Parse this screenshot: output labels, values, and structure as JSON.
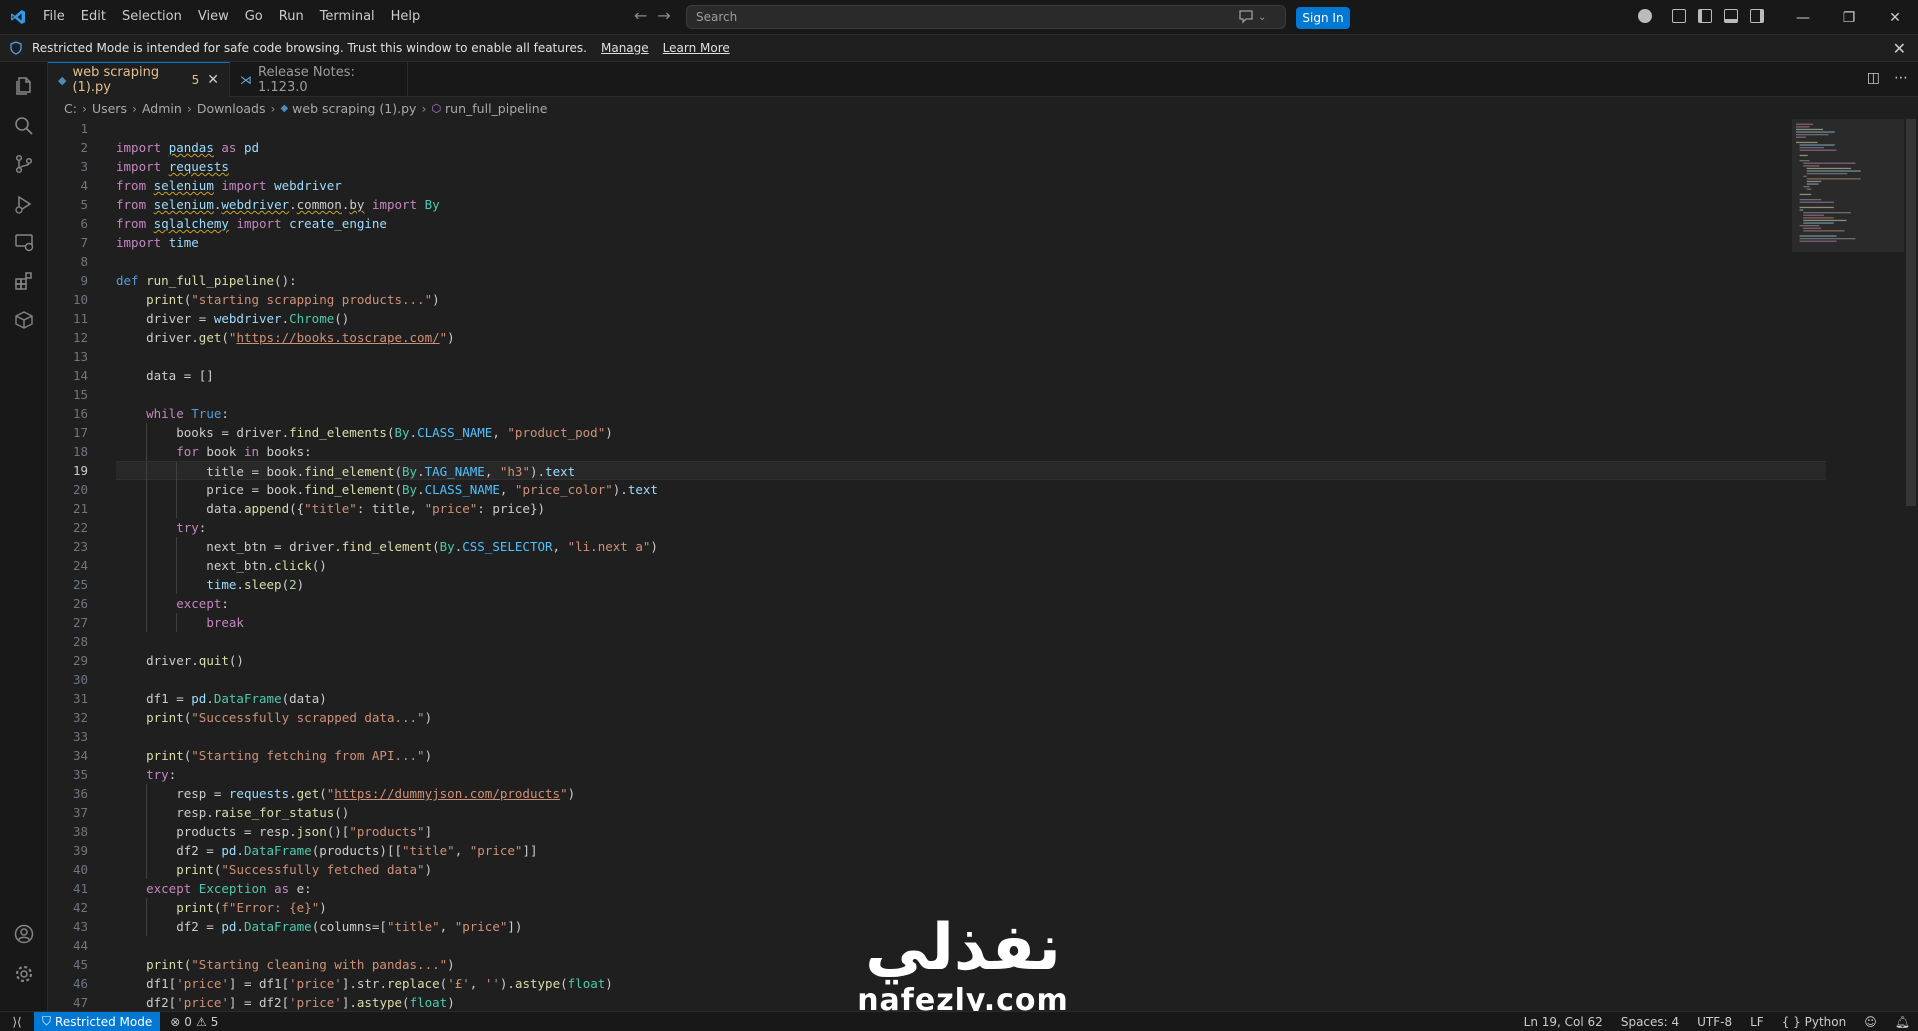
{
  "menu": [
    "File",
    "Edit",
    "Selection",
    "View",
    "Go",
    "Run",
    "Terminal",
    "Help"
  ],
  "search": {
    "placeholder": "Search"
  },
  "signin": "Sign In",
  "banner": {
    "text": "Restricted Mode is intended for safe code browsing. Trust this window to enable all features.",
    "manage": "Manage",
    "learn_more": "Learn More"
  },
  "tabs": [
    {
      "label": "web scraping (1).py",
      "badge": "5",
      "active": true
    },
    {
      "label": "Release Notes: 1.123.0",
      "active": false
    }
  ],
  "breadcrumb": [
    "C:",
    "Users",
    "Admin",
    "Downloads",
    "web scraping (1).py",
    "run_full_pipeline"
  ],
  "editor": {
    "current_line": 19,
    "lines": [
      "",
      "import pandas as pd",
      "import requests",
      "from selenium import webdriver",
      "from selenium.webdriver.common.by import By",
      "from sqlalchemy import create_engine",
      "import time",
      "",
      "def run_full_pipeline():",
      "    print(\"starting scrapping products...\")",
      "    driver = webdriver.Chrome()",
      "    driver.get(\"https://books.toscrape.com/\")",
      "",
      "    data = []",
      "",
      "    while True:",
      "        books = driver.find_elements(By.CLASS_NAME, \"product_pod\")",
      "        for book in books:",
      "            title = book.find_element(By.TAG_NAME, \"h3\").text",
      "            price = book.find_element(By.CLASS_NAME, \"price_color\").text",
      "            data.append({\"title\": title, \"price\": price})",
      "        try:",
      "            next_btn = driver.find_element(By.CSS_SELECTOR, \"li.next a\")",
      "            next_btn.click()",
      "            time.sleep(2)",
      "        except:",
      "            break",
      "",
      "    driver.quit()",
      "",
      "    df1 = pd.DataFrame(data)",
      "    print(\"Successfully scrapped data...\")",
      "",
      "    print(\"Starting fetching from API...\")",
      "    try:",
      "        resp = requests.get(\"https://dummyjson.com/products\")",
      "        resp.raise_for_status()",
      "        products = resp.json()[\"products\"]",
      "        df2 = pd.DataFrame(products)[[\"title\", \"price\"]]",
      "        print(\"Successfully fetched data\")",
      "    except Exception as e:",
      "        print(f\"Error: {e}\")",
      "        df2 = pd.DataFrame(columns=[\"title\", \"price\"])",
      "",
      "    print(\"Starting cleaning with pandas...\")",
      "    df1['price'] = df1['price'].str.replace('£', '').astype(float)",
      "    df2['price'] = df2['price'].astype(float)"
    ]
  },
  "watermark": {
    "arabic": "نفذلي",
    "latin": "nafezly.com"
  },
  "status": {
    "restricted": "Restricted Mode",
    "errors": "0",
    "warnings": "5",
    "position": "Ln 19, Col 62",
    "spaces": "Spaces: 4",
    "encoding": "UTF-8",
    "eol": "LF",
    "language": "Python"
  },
  "icons": {
    "files": "files-icon",
    "search": "search-icon",
    "scm": "source-control-icon",
    "debug": "run-debug-icon",
    "remote": "remote-explorer-icon",
    "extensions": "extensions-icon",
    "containers": "containers-icon",
    "accounts": "accounts-icon",
    "settings": "gear-icon"
  },
  "colors": {
    "accent": "#0078d4",
    "background": "#1f1f1f",
    "modified_tab": "#e2c08d"
  }
}
